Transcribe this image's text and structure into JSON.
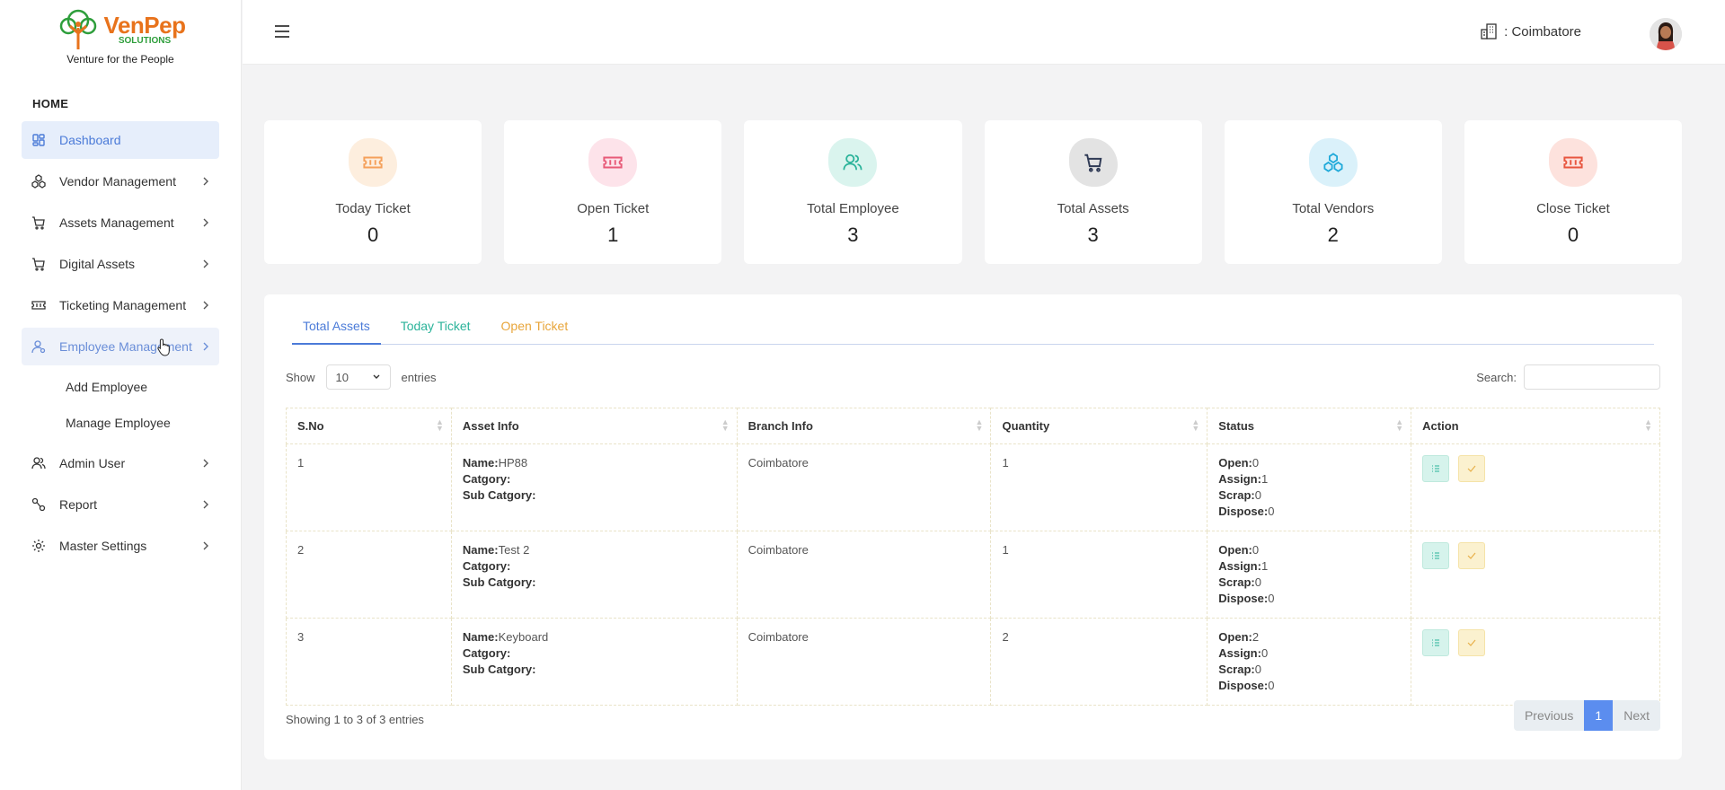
{
  "brand": {
    "name": "VenPep",
    "sub": "SOLUTIONS",
    "tagline": "Venture for the People"
  },
  "sidebar": {
    "section": "HOME",
    "items": [
      {
        "label": "Dashboard",
        "icon": "dashboard-icon"
      },
      {
        "label": "Vendor Management",
        "icon": "cubes-icon"
      },
      {
        "label": "Assets Management",
        "icon": "cart-icon"
      },
      {
        "label": "Digital Assets",
        "icon": "cart-icon"
      },
      {
        "label": "Ticketing Management",
        "icon": "ticket-icon"
      },
      {
        "label": "Employee Management",
        "icon": "user-icon"
      },
      {
        "label": "Admin User",
        "icon": "users-icon"
      },
      {
        "label": "Report",
        "icon": "route-icon"
      },
      {
        "label": "Master Settings",
        "icon": "gear-icon"
      }
    ],
    "sub_items": [
      "Add Employee",
      "Manage Employee"
    ]
  },
  "header": {
    "branch": ": Coimbatore"
  },
  "cards": [
    {
      "label": "Today Ticket",
      "value": "0",
      "icon": "ticket-icon",
      "color": "#f5a05a",
      "bg": "#fdeede"
    },
    {
      "label": "Open Ticket",
      "value": "1",
      "icon": "ticket-icon",
      "color": "#e85a78",
      "bg": "#fde3ea"
    },
    {
      "label": "Total Employee",
      "value": "3",
      "icon": "users-icon",
      "color": "#2bb39a",
      "bg": "#daf4ee"
    },
    {
      "label": "Total Assets",
      "value": "3",
      "icon": "cart-icon",
      "color": "#2f3a55",
      "bg": "#e3e3e3"
    },
    {
      "label": "Total Vendors",
      "value": "2",
      "icon": "cubes-icon",
      "color": "#1fa9d9",
      "bg": "#daf1fa"
    },
    {
      "label": "Close Ticket",
      "value": "0",
      "icon": "ticket-icon",
      "color": "#e8553e",
      "bg": "#fde2dd"
    }
  ],
  "tabs": [
    "Total Assets",
    "Today Ticket",
    "Open Ticket"
  ],
  "table_controls": {
    "show": "Show",
    "entries_value": "10",
    "entries": "entries",
    "search": "Search:"
  },
  "table": {
    "headers": [
      "S.No",
      "Asset Info",
      "Branch Info",
      "Quantity",
      "Status",
      "Action"
    ],
    "labels": {
      "name": "Name:",
      "category": "Catgory:",
      "sub_category": "Sub Catgory:",
      "open": "Open:",
      "assign": "Assign:",
      "scrap": "Scrap:",
      "dispose": "Dispose:"
    },
    "rows": [
      {
        "sno": "1",
        "name": "HP88",
        "branch": "Coimbatore",
        "qty": "1",
        "open": "0",
        "assign": "1",
        "scrap": "0",
        "dispose": "0"
      },
      {
        "sno": "2",
        "name": "Test 2",
        "branch": "Coimbatore",
        "qty": "1",
        "open": "0",
        "assign": "1",
        "scrap": "0",
        "dispose": "0"
      },
      {
        "sno": "3",
        "name": "Keyboard",
        "branch": "Coimbatore",
        "qty": "2",
        "open": "2",
        "assign": "0",
        "scrap": "0",
        "dispose": "0"
      }
    ]
  },
  "footer": {
    "info": "Showing 1 to 3 of 3 entries",
    "previous": "Previous",
    "page": "1",
    "next": "Next"
  }
}
